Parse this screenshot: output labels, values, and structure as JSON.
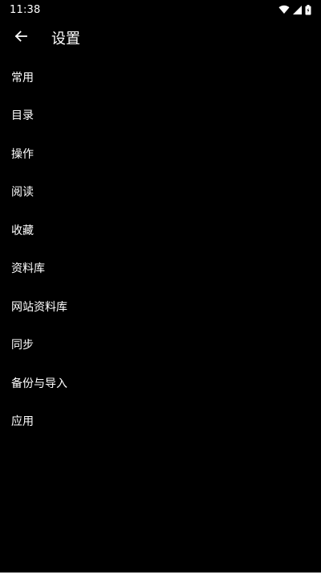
{
  "status_bar": {
    "time": "11:38",
    "icons": [
      "wifi-icon",
      "signal-icon",
      "battery-icon"
    ]
  },
  "header": {
    "back_icon": "arrow-left-icon",
    "title": "设置"
  },
  "settings": {
    "items": [
      {
        "label": "常用"
      },
      {
        "label": "目录"
      },
      {
        "label": "操作"
      },
      {
        "label": "阅读"
      },
      {
        "label": "收藏"
      },
      {
        "label": "资料库"
      },
      {
        "label": "网站资料库"
      },
      {
        "label": "同步"
      },
      {
        "label": "备份与导入"
      },
      {
        "label": "应用"
      }
    ]
  },
  "colors": {
    "background": "#000000",
    "text": "#ffffff"
  }
}
